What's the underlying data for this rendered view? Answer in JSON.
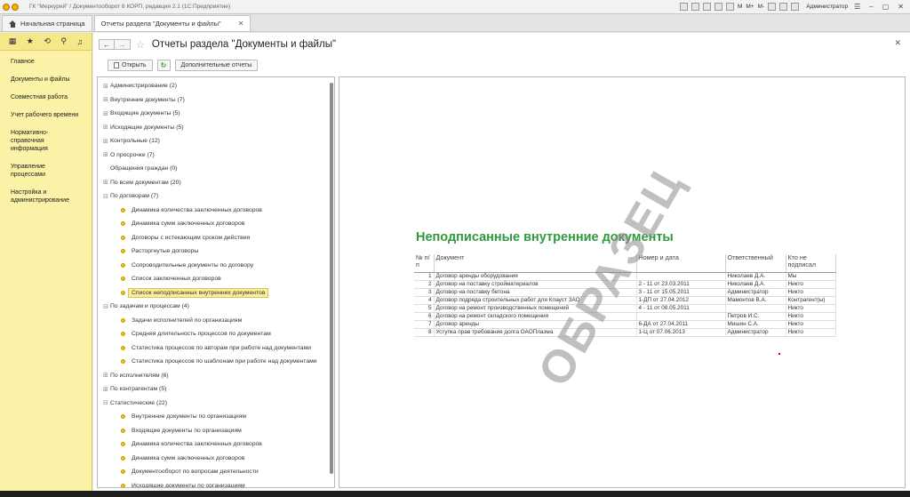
{
  "window": {
    "title": "ГК \"Меркурий\" / Документооборот 8 КОРП, редакция 2.1 (1С:Предприятие)",
    "user": "Администратор"
  },
  "tabs": [
    {
      "label": "Начальная страница"
    },
    {
      "label": "Отчеты раздела \"Документы и файлы\""
    }
  ],
  "sidebar": {
    "items": [
      {
        "label": "Главное"
      },
      {
        "label": "Документы и файлы"
      },
      {
        "label": "Совместная работа"
      },
      {
        "label": "Учет рабочего времени"
      },
      {
        "label": "Нормативно-справочная информация"
      },
      {
        "label": "Управление процессами"
      },
      {
        "label": "Настройка и администрирование"
      }
    ]
  },
  "page": {
    "title": "Отчеты раздела \"Документы и файлы\""
  },
  "toolbar": {
    "open_label": "Открыть",
    "more_label": "Дополнительные отчеты"
  },
  "tree": [
    {
      "label": "Администрирование (2)",
      "level": 0,
      "expandable": true
    },
    {
      "label": "Внутренние документы (7)",
      "level": 0,
      "expandable": true
    },
    {
      "label": "Входящие документы (5)",
      "level": 0,
      "expandable": true
    },
    {
      "label": "Исходящие документы (5)",
      "level": 0,
      "expandable": true
    },
    {
      "label": "Контрольные (12)",
      "level": 0,
      "expandable": true
    },
    {
      "label": "О просрочке (7)",
      "level": 0,
      "expandable": true
    },
    {
      "label": "Обращения граждан (0)",
      "level": 0,
      "expandable": false
    },
    {
      "label": "По всем документам (20)",
      "level": 0,
      "expandable": true
    },
    {
      "label": "По договорам (7)",
      "level": 0,
      "expandable": true,
      "expanded": true
    },
    {
      "label": "Динамика количества заключенных договоров",
      "level": 1
    },
    {
      "label": "Динамика сумм заключенных договоров",
      "level": 1
    },
    {
      "label": "Договоры с истекающим сроком действия",
      "level": 1
    },
    {
      "label": "Расторгнутые договоры",
      "level": 1
    },
    {
      "label": "Сопроводительные документы по договору",
      "level": 1
    },
    {
      "label": "Список заключенных договоров",
      "level": 1
    },
    {
      "label": "Список неподписанных внутренних документов",
      "level": 1,
      "selected": true
    },
    {
      "label": "По задачам и процессам (4)",
      "level": 0,
      "expandable": true,
      "expanded": true
    },
    {
      "label": "Задачи исполнителей  по организациям",
      "level": 1
    },
    {
      "label": "Средняя длительность процессов по документам",
      "level": 1
    },
    {
      "label": "Статистика процессов по авторам при работе над документами",
      "level": 1
    },
    {
      "label": "Статистика процессов по шаблонам при работе над документами",
      "level": 1
    },
    {
      "label": "По исполнителям (6)",
      "level": 0,
      "expandable": true
    },
    {
      "label": "По контрагентам (5)",
      "level": 0,
      "expandable": true
    },
    {
      "label": "Статистические (22)",
      "level": 0,
      "expandable": true,
      "expanded": true
    },
    {
      "label": "Внутренние документы по организациям",
      "level": 1
    },
    {
      "label": "Входящие документы по организациям",
      "level": 1
    },
    {
      "label": "Динамика количества заключенных договоров",
      "level": 1
    },
    {
      "label": "Динамика сумм заключенных договоров",
      "level": 1
    },
    {
      "label": "Документооборот по вопросам деятельности",
      "level": 1
    },
    {
      "label": "Исходящие документы по организациям",
      "level": 1
    }
  ],
  "report": {
    "title": "Неподписанные внутренние документы",
    "headers": {
      "n": "№ п/п",
      "doc": "Документ",
      "num": "Номер и дата",
      "resp": "Ответственный",
      "ns": "Кто не подписал"
    },
    "rows": [
      {
        "n": "1",
        "doc": "Договор аренды оборудования",
        "num": "",
        "resp": "Николаев Д.А.",
        "ns": "Мы"
      },
      {
        "n": "2",
        "doc": "Договор на поставку стройматериалов",
        "num": "2 - 11 от 23.03.2011",
        "resp": "Николаев Д.А.",
        "ns": "Никто"
      },
      {
        "n": "3",
        "doc": "Договор на поставку бетона",
        "num": "3 - 11 от 15.05.2011",
        "resp": "Администратор",
        "ns": "Никто"
      },
      {
        "n": "4",
        "doc": "Договор подряда строительных работ для Клауст ЗАО",
        "num": "1-ДП от 27.04.2012",
        "resp": "Мамонтов В.А.",
        "ns": "Контрагент(ы)"
      },
      {
        "n": "5",
        "doc": "Договор на ремонт производственных помещений",
        "num": "4 - 11 от 08.05.2011",
        "resp": "",
        "ns": "Никто"
      },
      {
        "n": "6",
        "doc": "Договор на ремонт складского помещения",
        "num": "",
        "resp": "Петров И.С.",
        "ns": "Никто"
      },
      {
        "n": "7",
        "doc": "Договор аренды",
        "num": "6-ДА от 27.04.2011",
        "resp": "Мишин С.А.",
        "ns": "Никто"
      },
      {
        "n": "8",
        "doc": "Уступка прав требования долга ОАОПлазма",
        "num": "1-Ц от 07.06.2013",
        "resp": "Администратор",
        "ns": "Никто"
      }
    ],
    "watermark": "ОБРАЗЕЦ"
  },
  "colors": {
    "sidebar_bg": "#fbf1a7",
    "accent_green": "#2f9a3c",
    "bullet": "#f0c20e",
    "selected_bg": "#f9ee9a"
  }
}
